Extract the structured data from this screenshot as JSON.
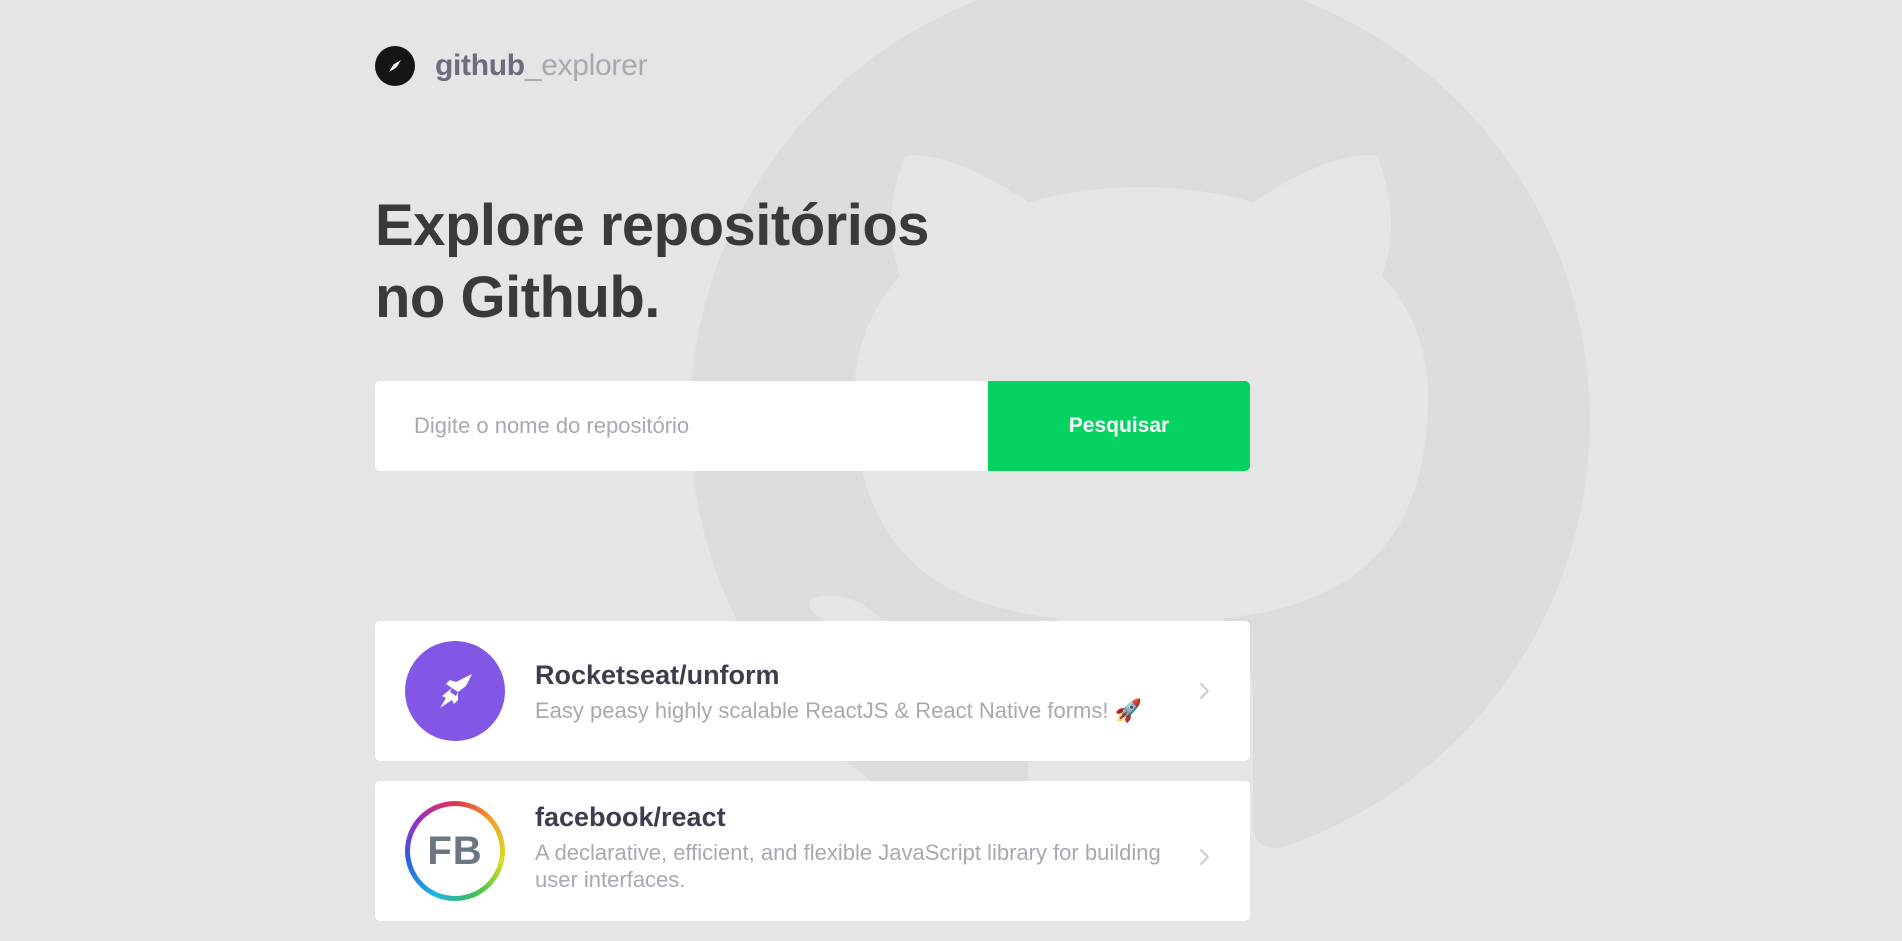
{
  "brand": {
    "name_part1": "github",
    "name_part2": "_explorer",
    "icon": "compass-icon"
  },
  "hero": {
    "title_line1": "Explore repositórios",
    "title_line2": "no Github."
  },
  "search": {
    "placeholder": "Digite o nome do repositório",
    "value": "",
    "button_label": "Pesquisar"
  },
  "repositories": [
    {
      "name": "Rocketseat/unform",
      "description": "Easy peasy highly scalable ReactJS & React Native forms! 🚀",
      "avatar": "unform-logo-icon",
      "avatar_color": "#8257e5"
    },
    {
      "name": "facebook/react",
      "description": "A declarative, efficient, and flexible JavaScript library for building user interfaces.",
      "avatar": "fb-logo-icon",
      "avatar_text": "FB"
    }
  ],
  "colors": {
    "background": "#e5e5e5",
    "accent": "#04d361",
    "title": "#3a3a3a",
    "muted": "#a8a8b3"
  }
}
